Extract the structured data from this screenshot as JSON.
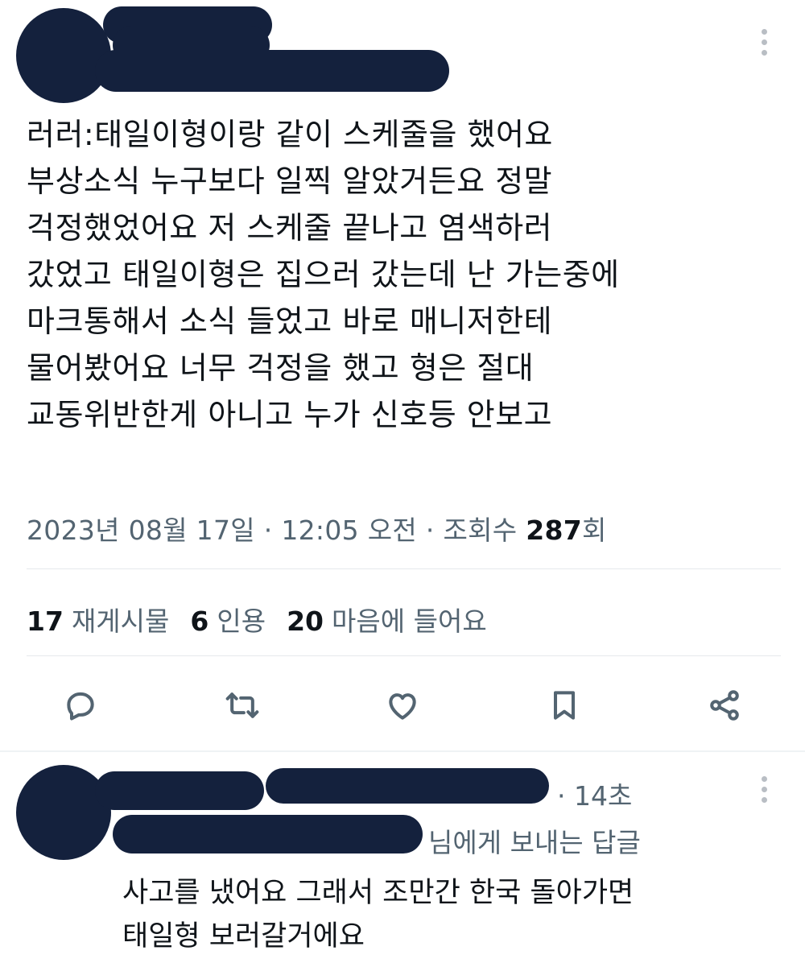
{
  "tweet": {
    "body_lines": [
      "러러:태일이형이랑 같이 스케줄을 했어요",
      "부상소식 누구보다 일찍 알았거든요 정말",
      "걱정했었어요 저 스케줄 끝나고 염색하러",
      "갔었고 태일이형은 집으러 갔는데 난 가는중에",
      "마크통해서 소식 들었고 바로 매니저한테",
      "물어봤어요 너무 걱정을 했고 형은 절대",
      "교동위반한게 아니고 누가 신호등 안보고"
    ],
    "meta": {
      "date": "2023년 08월 17일",
      "separator": "·",
      "time": "12:05 오전",
      "views_label": "조회수",
      "views_count": "287",
      "views_suffix": "회"
    },
    "stats": [
      {
        "count": "17",
        "label": "재게시물"
      },
      {
        "count": "6",
        "label": "인용"
      },
      {
        "count": "20",
        "label": "마음에 들어요"
      }
    ],
    "actions": [
      "reply-icon",
      "repost-icon",
      "like-icon",
      "bookmark-icon",
      "share-icon"
    ]
  },
  "reply": {
    "time": "· 14초",
    "replying_to": "님에게 보내는 답글",
    "text_lines": [
      "사고를 냈어요 그래서 조만간 한국 돌아가면",
      "태일형 보러갈거에요"
    ]
  },
  "colors": {
    "text": "#0f1419",
    "secondary": "#536471",
    "redaction": "#14213d",
    "divider": "#e6e9ec"
  }
}
